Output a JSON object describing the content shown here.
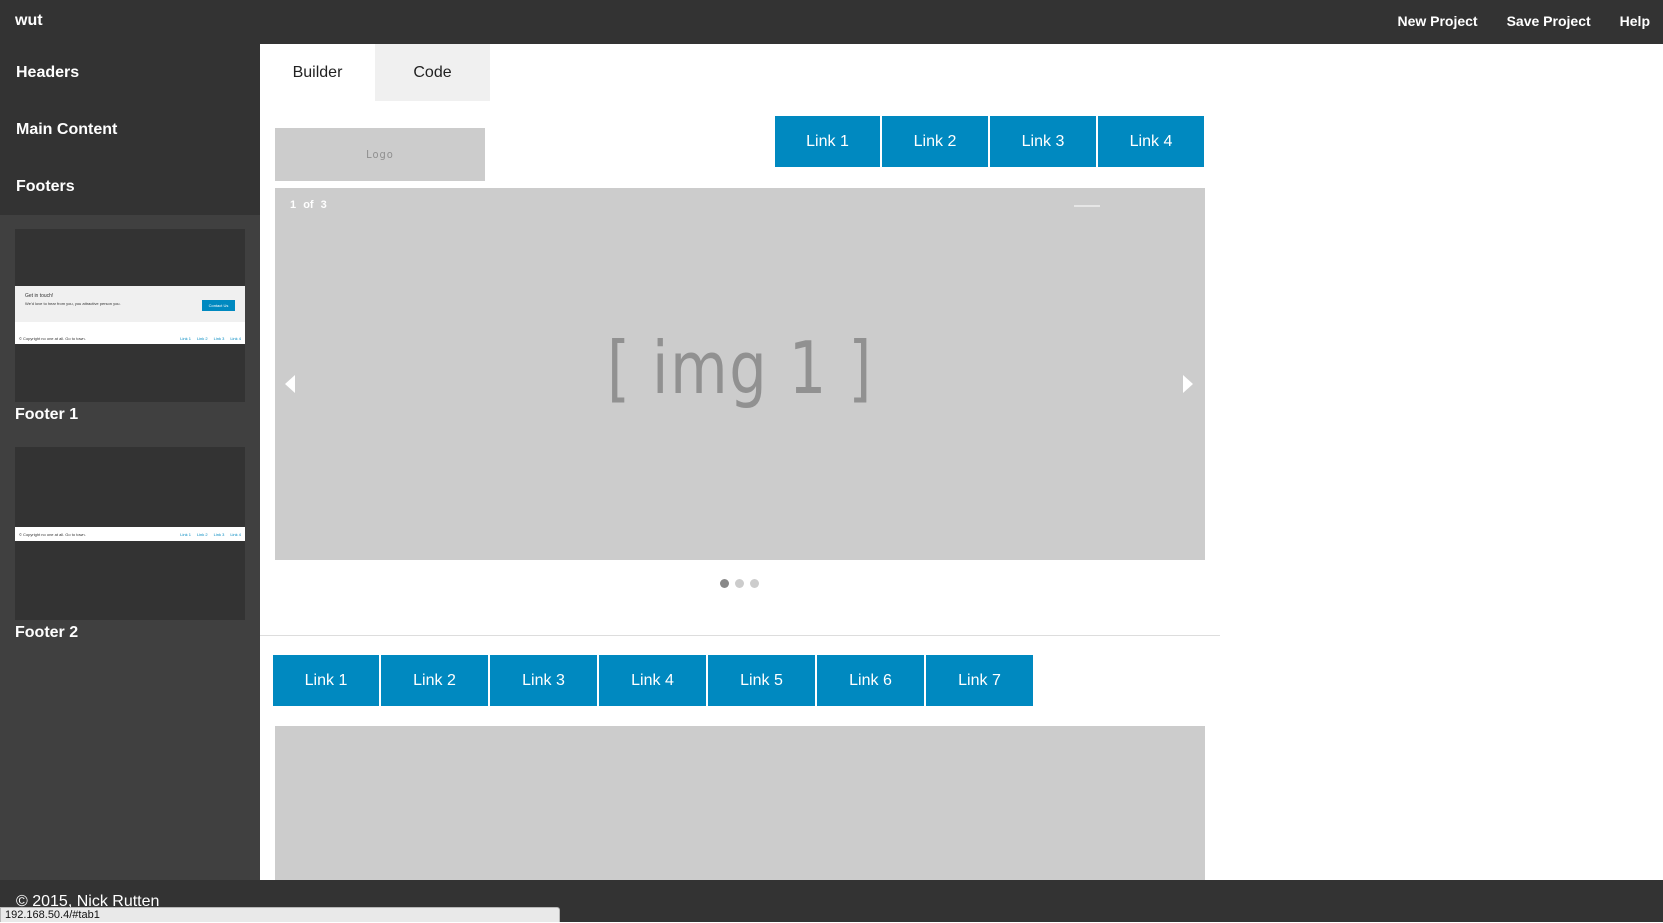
{
  "topbar": {
    "brand": "wut",
    "nav": [
      "New Project",
      "Save Project",
      "Help"
    ]
  },
  "sidebar": {
    "categories": [
      "Headers",
      "Main Content",
      "Footers"
    ],
    "thumbnails": [
      {
        "label": "Footer 1",
        "preview": {
          "heading": "Get in touch!",
          "subtext": "We'd love to hear from you, you attractive person you.",
          "button": "Contact Us",
          "copyright": "© Copyright no one at all. Go to town.",
          "links": [
            "Link 1",
            "Link 2",
            "Link 3",
            "Link 4"
          ]
        }
      },
      {
        "label": "Footer 2",
        "preview": {
          "copyright": "© Copyright no one at all. Go to town.",
          "links": [
            "Link 1",
            "Link 2",
            "Link 3",
            "Link 4"
          ]
        }
      }
    ]
  },
  "tabs": [
    "Builder",
    "Code"
  ],
  "active_tab": "Code",
  "canvas": {
    "logo": "Logo",
    "header_links": [
      "Link 1",
      "Link 2",
      "Link 3",
      "Link 4"
    ],
    "carousel": {
      "current": "1",
      "of": "of",
      "total": "3",
      "image_text": "[ img 1 ]",
      "slides": 3,
      "active_slide": 1
    },
    "nav_links": [
      "Link 1",
      "Link 2",
      "Link 3",
      "Link 4",
      "Link 5",
      "Link 6",
      "Link 7"
    ]
  },
  "footer": {
    "text": "© 2015, Nick Rutten"
  },
  "statusbar": {
    "url": "192.168.50.4/#tab1"
  },
  "colors": {
    "accent": "#0089c0",
    "dark": "#333333",
    "placeholder": "#cccccc"
  }
}
